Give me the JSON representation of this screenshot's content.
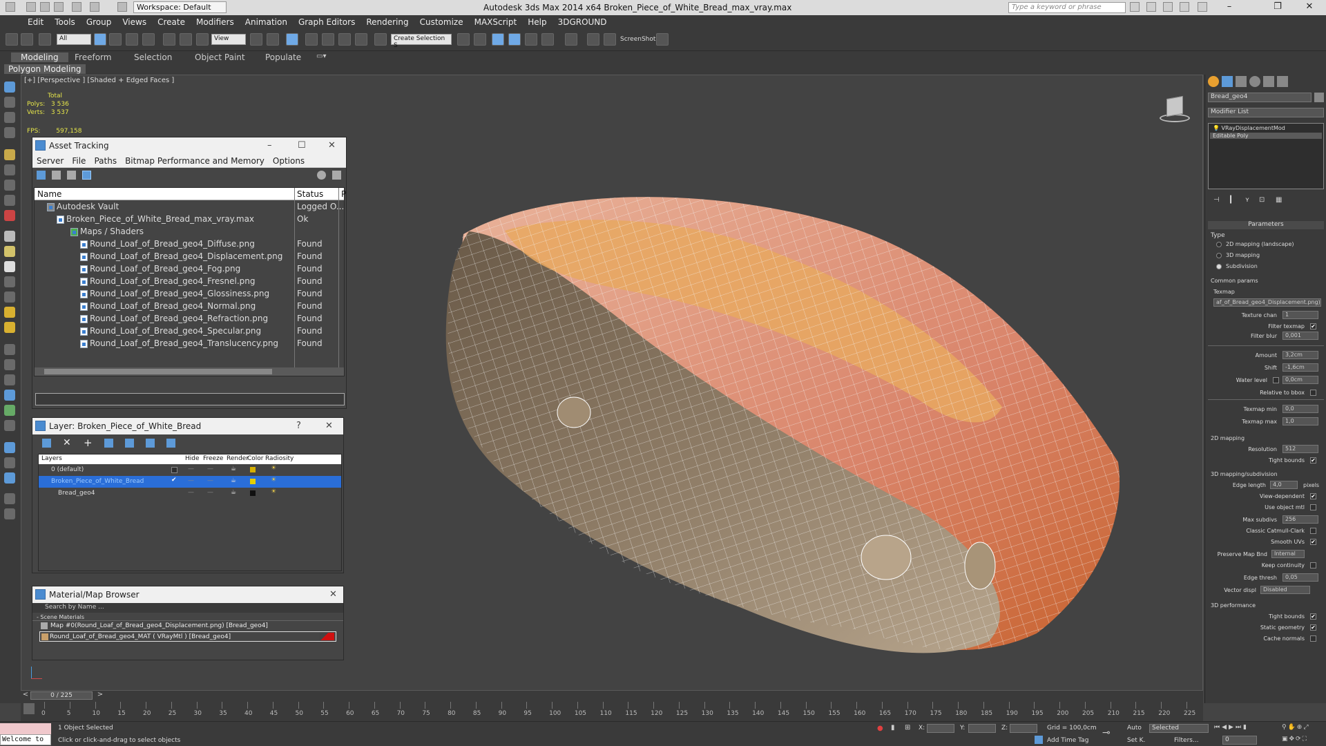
{
  "app": {
    "window_title": "Autodesk 3ds Max  2014 x64     Broken_Piece_of_White_Bread_max_vray.max",
    "workspace": "Workspace: Default",
    "search_placeholder": "Type a keyword or phrase"
  },
  "menu": [
    "Edit",
    "Tools",
    "Group",
    "Views",
    "Create",
    "Modifiers",
    "Animation",
    "Graph Editors",
    "Rendering",
    "Customize",
    "MAXScript",
    "Help",
    "3DGROUND"
  ],
  "toolbar": {
    "filter": "All",
    "view": "View",
    "selection_set": "Create Selection S",
    "screenshot": "ScreenShot"
  },
  "ribbon": {
    "tabs": [
      "Modeling",
      "Freeform",
      "Selection",
      "Object Paint",
      "Populate"
    ],
    "sub": "Polygon Modeling"
  },
  "viewport": {
    "label": "[+] [Perspective ] [Shaded + Edged Faces ]",
    "stats_total": "Total",
    "polys_label": "Polys:",
    "polys": "3 536",
    "verts_label": "Verts:",
    "verts": "3 537",
    "fps_label": "FPS:",
    "fps": "597,158"
  },
  "asset_tracking": {
    "title": "Asset Tracking",
    "menu": [
      "Server",
      "File",
      "Paths",
      "Bitmap Performance and Memory",
      "Options"
    ],
    "col_name": "Name",
    "col_status": "Status",
    "col_p": "P",
    "rows": [
      {
        "name": "Autodesk Vault",
        "status": "Logged O...",
        "indent": 0
      },
      {
        "name": "Broken_Piece_of_White_Bread_max_vray.max",
        "status": "Ok",
        "indent": 1
      },
      {
        "name": "Maps / Shaders",
        "status": "",
        "indent": 2
      },
      {
        "name": "Round_Loaf_of_Bread_geo4_Diffuse.png",
        "status": "Found",
        "indent": 3
      },
      {
        "name": "Round_Loaf_of_Bread_geo4_Displacement.png",
        "status": "Found",
        "indent": 3
      },
      {
        "name": "Round_Loaf_of_Bread_geo4_Fog.png",
        "status": "Found",
        "indent": 3
      },
      {
        "name": "Round_Loaf_of_Bread_geo4_Fresnel.png",
        "status": "Found",
        "indent": 3
      },
      {
        "name": "Round_Loaf_of_Bread_geo4_Glossiness.png",
        "status": "Found",
        "indent": 3
      },
      {
        "name": "Round_Loaf_of_Bread_geo4_Normal.png",
        "status": "Found",
        "indent": 3
      },
      {
        "name": "Round_Loaf_of_Bread_geo4_Refraction.png",
        "status": "Found",
        "indent": 3
      },
      {
        "name": "Round_Loaf_of_Bread_geo4_Specular.png",
        "status": "Found",
        "indent": 3
      },
      {
        "name": "Round_Loaf_of_Bread_geo4_Translucency.png",
        "status": "Found",
        "indent": 3
      }
    ]
  },
  "layer_panel": {
    "title": "Layer: Broken_Piece_of_White_Bread",
    "cols": [
      "Layers",
      "Hide",
      "Freeze",
      "Render",
      "Color",
      "Radiosity"
    ],
    "rows": [
      {
        "name": "0 (default)",
        "color": "#d6b000"
      },
      {
        "name": "Broken_Piece_of_White_Bread",
        "color": "#e6d000"
      },
      {
        "name": "Bread_geo4",
        "color": "#111111"
      }
    ]
  },
  "material_browser": {
    "title": "Material/Map Browser",
    "search": "Search by Name ...",
    "group": "- Scene Materials",
    "items": [
      "Map #0(Round_Loaf_of_Bread_geo4_Displacement.png) [Bread_geo4]",
      "Round_Loaf_of_Bread_geo4_MAT ( VRayMtl ) [Bread_geo4]"
    ]
  },
  "command_panel": {
    "object_name": "Bread_geo4",
    "modifier_list": "Modifier List",
    "stack": [
      "VRayDisplacementMod",
      "Editable Poly"
    ],
    "rollout": "Parameters",
    "type_label": "Type",
    "type_options": [
      "2D mapping (landscape)",
      "3D mapping",
      "Subdivision"
    ],
    "common_params": "Common params",
    "texmap_label": "Texmap",
    "texmap": "af_of_Bread_geo4_Displacement.png)",
    "texture_chan_label": "Texture chan",
    "texture_chan": "1",
    "filter_texmap": "Filter texmap",
    "filter_blur_label": "Filter blur",
    "filter_blur": "0,001",
    "amount_label": "Amount",
    "amount": "3,2cm",
    "shift_label": "Shift",
    "shift": "-1,6cm",
    "water_level_label": "Water level",
    "water_level": "0,0cm",
    "relative_bbox": "Relative to bbox",
    "texmap_min_label": "Texmap min",
    "texmap_min": "0,0",
    "texmap_max_label": "Texmap max",
    "texmap_max": "1,0",
    "mapping2d": "2D mapping",
    "resolution_label": "Resolution",
    "resolution": "512",
    "tight_bounds": "Tight bounds",
    "mapping3d": "3D mapping/subdivision",
    "edge_length_label": "Edge length",
    "edge_length": "4,0",
    "pixels": "pixels",
    "view_dependent": "View-dependent",
    "use_object_mtl": "Use object mtl",
    "max_subdivs_label": "Max subdivs",
    "max_subdivs": "256",
    "classic_catmull": "Classic Catmull-Clark",
    "smooth_uvs": "Smooth UVs",
    "preserve_map_label": "Preserve Map Bnd",
    "preserve_map": "Internal",
    "keep_continuity": "Keep continuity",
    "edge_thresh_label": "Edge thresh",
    "edge_thresh": "0,05",
    "vector_displ_label": "Vector displ",
    "vector_displ": "Disabled",
    "perf": "3D performance",
    "tight_bounds2": "Tight bounds",
    "static_geometry": "Static geometry",
    "cache_normals": "Cache normals"
  },
  "timeline": {
    "frame": "0 / 225",
    "ticks": [
      "0",
      "5",
      "10",
      "15",
      "20",
      "25",
      "30",
      "35",
      "40",
      "45",
      "50",
      "55",
      "60",
      "65",
      "70",
      "75",
      "80",
      "85",
      "90",
      "95",
      "100",
      "105",
      "110",
      "115",
      "120",
      "125",
      "130",
      "135",
      "140",
      "145",
      "150",
      "155",
      "160",
      "165",
      "170",
      "175",
      "180",
      "185",
      "190",
      "195",
      "200",
      "205",
      "210",
      "215",
      "220",
      "225"
    ],
    "frame_fraction": 0
  },
  "status": {
    "welcome": "Welcome to",
    "selected": "1 Object Selected",
    "hint": "Click or click-and-drag to select objects",
    "x": "X:",
    "y": "Y:",
    "z": "Z:",
    "grid": "Grid = 100,0cm",
    "add_time_tag": "Add Time Tag",
    "auto": "Auto",
    "setk": "Set K.",
    "selected_dd": "Selected",
    "filters": "Filters...",
    "frame_field": "0"
  }
}
